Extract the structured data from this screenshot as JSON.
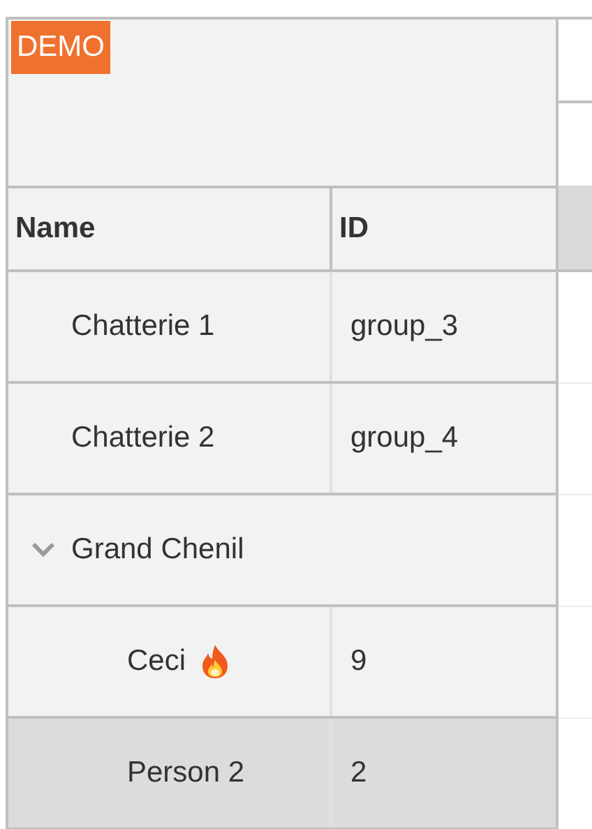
{
  "badge": "DEMO",
  "columns": [
    {
      "label": "Name"
    },
    {
      "label": "ID"
    }
  ],
  "rows": [
    {
      "name": "Chatterie 1",
      "id": "group_3",
      "selected": false
    },
    {
      "name": "Chatterie 2",
      "id": "group_4",
      "selected": false
    },
    {
      "name": "Grand Chenil",
      "kind": "group",
      "expanded": true,
      "selected": false,
      "children": [
        {
          "name": "Ceci",
          "id": "9",
          "hot": true,
          "selected": false
        },
        {
          "name": "Person 2",
          "id": "2",
          "hot": false,
          "selected": true
        }
      ]
    }
  ]
}
